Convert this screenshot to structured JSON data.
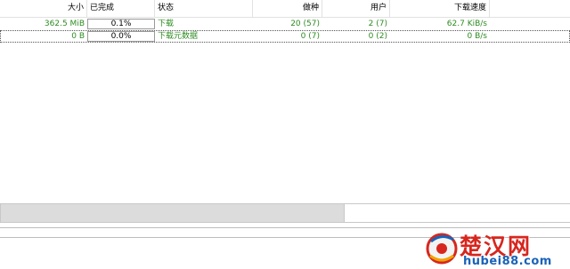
{
  "columns": {
    "size": "大小",
    "done": "已完成",
    "status": "状态",
    "seeds": "做种",
    "peers": "用户",
    "down_speed": "下载速度"
  },
  "rows": [
    {
      "size": "362.5 MiB",
      "done": "0.1%",
      "progress": 0.001,
      "status": "下载",
      "seeds": "20 (57)",
      "peers": "2 (7)",
      "down_speed": "62.7 KiB/s"
    },
    {
      "size": "0 B",
      "done": "0.0%",
      "progress": 0.0,
      "status": "下载元数据",
      "seeds": "0 (7)",
      "peers": "0 (2)",
      "down_speed": "0 B/s"
    }
  ],
  "watermark": {
    "title": "楚汉网",
    "url": "hubei88.com"
  },
  "colors": {
    "status_text": "#2e8b22",
    "progress_fill": "#a6d96a",
    "watermark_red": "#d7261e",
    "watermark_blue": "#1a63b8"
  }
}
